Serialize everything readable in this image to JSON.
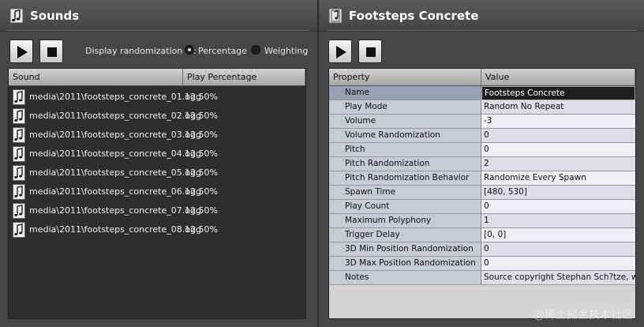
{
  "left_panel": {
    "title": "Sounds",
    "randomization_label": "Display randomization in:",
    "options": [
      {
        "label": "Percentage",
        "checked": true
      },
      {
        "label": "Weighting",
        "checked": false
      }
    ],
    "columns": [
      "Sound",
      "Play Percentage"
    ],
    "rows": [
      {
        "name": "media\\2011\\footsteps_concrete_01.ogg",
        "pct": "12.50%"
      },
      {
        "name": "media\\2011\\footsteps_concrete_02.ogg",
        "pct": "12.50%"
      },
      {
        "name": "media\\2011\\footsteps_concrete_03.ogg",
        "pct": "12.50%"
      },
      {
        "name": "media\\2011\\footsteps_concrete_04.ogg",
        "pct": "12.50%"
      },
      {
        "name": "media\\2011\\footsteps_concrete_05.ogg",
        "pct": "12.50%"
      },
      {
        "name": "media\\2011\\footsteps_concrete_06.ogg",
        "pct": "12.50%"
      },
      {
        "name": "media\\2011\\footsteps_concrete_07.ogg",
        "pct": "12.50%"
      },
      {
        "name": "media\\2011\\footsteps_concrete_08.ogg",
        "pct": "12.50%"
      }
    ]
  },
  "right_panel": {
    "title": "Footsteps Concrete",
    "columns": [
      "Property",
      "Value"
    ],
    "properties": [
      {
        "name": "Name",
        "value": "Footsteps Concrete"
      },
      {
        "name": "Play Mode",
        "value": "Random No Repeat"
      },
      {
        "name": "Volume",
        "value": "-3"
      },
      {
        "name": "Volume Randomization",
        "value": "0"
      },
      {
        "name": "Pitch",
        "value": "0"
      },
      {
        "name": "Pitch Randomization",
        "value": "2"
      },
      {
        "name": "Pitch Randomization Behavior",
        "value": "Randomize Every Spawn"
      },
      {
        "name": "Spawn Time",
        "value": "[480, 530]"
      },
      {
        "name": "Play Count",
        "value": "0"
      },
      {
        "name": "Maximum Polyphony",
        "value": "1"
      },
      {
        "name": "Trigger Delay",
        "value": "[0, 0]"
      },
      {
        "name": "3D Min Position Randomization",
        "value": "0"
      },
      {
        "name": "3D Max Position Randomization",
        "value": "0"
      },
      {
        "name": "Notes",
        "value": "Source copyright Stephan Sch?tze, w..."
      }
    ]
  },
  "icons": {
    "title": "music-note-icon",
    "play": "play-icon",
    "stop": "stop-icon",
    "row": "sound-file-icon"
  },
  "watermark": "@稀土掘金技术社区"
}
